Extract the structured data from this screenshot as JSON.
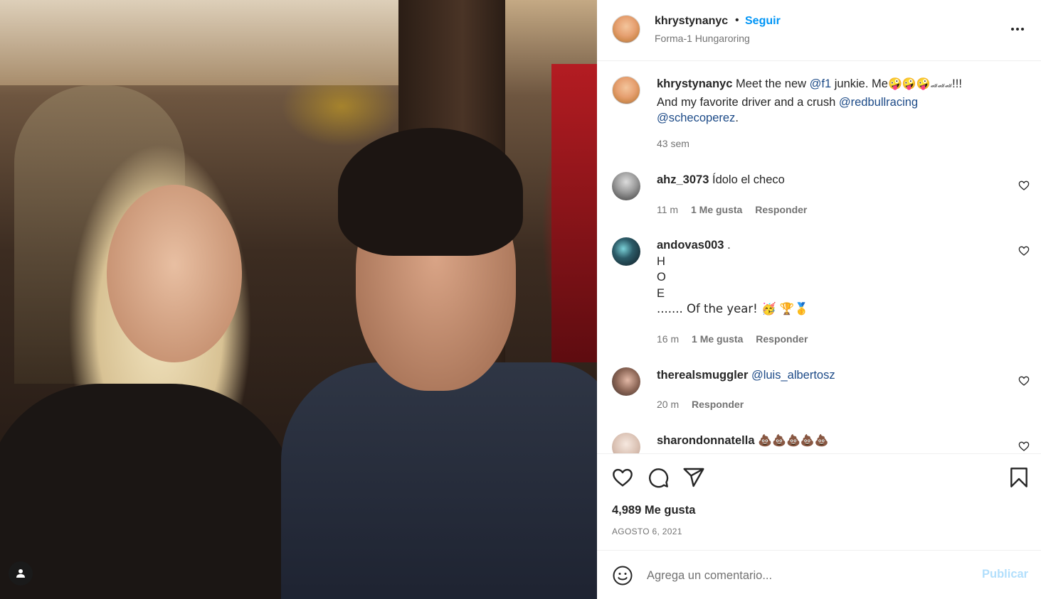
{
  "post": {
    "header": {
      "username": "khrystynanyc",
      "separator": "•",
      "follow_label": "Seguir",
      "location": "Forma-1 Hungaroring"
    },
    "caption": {
      "username": "khrystynanyc",
      "text_1": "Meet the new ",
      "mention_1": "@f1",
      "text_2": " junkie. Me",
      "emojis": "🤪🤪🤪",
      "cars": "🏎🏎🏎",
      "text_3": "!!!",
      "text_4": "And my favorite driver and a crush ",
      "mention_2": "@redbullracing",
      "mention_3": "@schecoperez",
      "text_5": ".",
      "age": "43 sem"
    },
    "comments": [
      {
        "username": "ahz_3073",
        "text": "Ídolo el checo",
        "age": "11 m",
        "likes": "1 Me gusta",
        "reply": "Responder"
      },
      {
        "username": "andovas003",
        "lines": [
          ".",
          "H",
          "O",
          "E",
          "....... Of the year! 🥳 🏆🥇"
        ],
        "age": "16 m",
        "likes": "1 Me gusta",
        "reply": "Responder"
      },
      {
        "username": "therealsmuggler",
        "mention": "@luis_albertosz",
        "age": "20 m",
        "reply": "Responder"
      },
      {
        "username": "sharondonnatella",
        "text": "💩💩💩💩💩"
      }
    ],
    "likes_text": "4,989 Me gusta",
    "date": "AGOSTO 6, 2021",
    "comment_box": {
      "placeholder": "Agrega un comentario...",
      "publish_label": "Publicar"
    }
  },
  "icons": {
    "more": "more-options-icon",
    "like": "heart-icon",
    "comment": "comment-icon",
    "share": "share-icon",
    "save": "bookmark-icon",
    "emoji": "emoji-icon",
    "tag": "user-tag-icon"
  },
  "colors": {
    "link": "#0095f6",
    "mention": "#1c4a87",
    "muted": "#737373",
    "publish_disabled": "#b2dffc"
  }
}
